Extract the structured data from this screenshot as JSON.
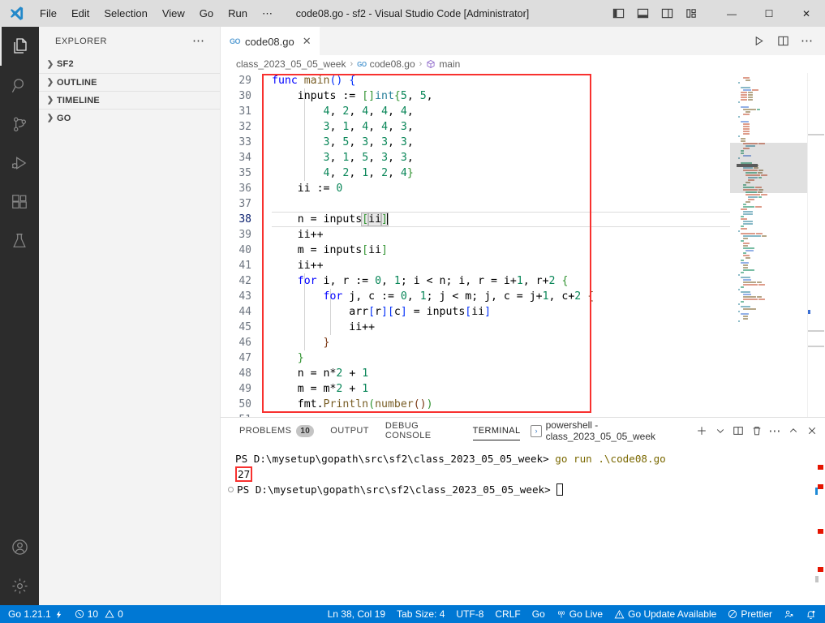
{
  "titlebar": {
    "logo_icon": "vscode-logo-icon",
    "menus": [
      "File",
      "Edit",
      "Selection",
      "View",
      "Go",
      "Run",
      "⋯"
    ],
    "title": "code08.go - sf2 - Visual Studio Code [Administrator]",
    "layout_icons": [
      "toggle-primary-sidebar-icon",
      "toggle-panel-icon",
      "toggle-secondary-sidebar-icon",
      "customize-layout-icon"
    ],
    "window_controls": {
      "minimize": "—",
      "maximize": "☐",
      "close": "✕"
    }
  },
  "activitybar": {
    "items": [
      {
        "name": "explorer",
        "icon": "files-icon",
        "active": true
      },
      {
        "name": "search",
        "icon": "search-icon",
        "active": false
      },
      {
        "name": "source-control",
        "icon": "source-control-icon",
        "active": false
      },
      {
        "name": "run-and-debug",
        "icon": "run-debug-icon",
        "active": false
      },
      {
        "name": "extensions",
        "icon": "extensions-icon",
        "active": false
      },
      {
        "name": "testing",
        "icon": "beaker-icon",
        "active": false
      }
    ],
    "bottom_items": [
      {
        "name": "accounts",
        "icon": "account-icon"
      },
      {
        "name": "manage",
        "icon": "gear-icon"
      }
    ]
  },
  "sidebar": {
    "header": "EXPLORER",
    "more_actions": "⋯",
    "sections": [
      {
        "label": "SF2",
        "expanded": false
      },
      {
        "label": "OUTLINE",
        "expanded": false
      },
      {
        "label": "TIMELINE",
        "expanded": false
      },
      {
        "label": "GO",
        "expanded": false
      }
    ]
  },
  "editor": {
    "tabs": [
      {
        "label": "code08.go",
        "icon": "go-file-icon",
        "close": "✕",
        "active": true
      }
    ],
    "actions": [
      "run-icon",
      "split-editor-icon",
      "more-actions-icon"
    ],
    "breadcrumb": [
      {
        "label": "class_2023_05_05_week",
        "icon": ""
      },
      {
        "label": "code08.go",
        "icon": "go-file-icon"
      },
      {
        "label": "main",
        "icon": "symbol-package-icon"
      }
    ],
    "breadcrumb_separator": "›",
    "first_line_number": 29,
    "lines": [
      {
        "n": 29,
        "tokens": [
          {
            "t": "func ",
            "c": "kw"
          },
          {
            "t": "main",
            "c": "fn"
          },
          {
            "t": "(",
            "c": "br1"
          },
          {
            "t": ")",
            "c": "br1"
          },
          {
            "t": " ",
            "c": "op"
          },
          {
            "t": "{",
            "c": "br1"
          }
        ]
      },
      {
        "n": 30,
        "tokens": [
          {
            "t": "    inputs ",
            "c": "op"
          },
          {
            "t": ":=",
            "c": "op"
          },
          {
            "t": " ",
            "c": "op"
          },
          {
            "t": "[",
            "c": "br2"
          },
          {
            "t": "]",
            "c": "br2"
          },
          {
            "t": "int",
            "c": "typ"
          },
          {
            "t": "{",
            "c": "br2"
          },
          {
            "t": "5",
            "c": "num"
          },
          {
            "t": ", ",
            "c": "op"
          },
          {
            "t": "5",
            "c": "num"
          },
          {
            "t": ",",
            "c": "op"
          }
        ]
      },
      {
        "n": 31,
        "tokens": [
          {
            "t": "        ",
            "c": "op"
          },
          {
            "t": "4",
            "c": "num"
          },
          {
            "t": ", ",
            "c": "op"
          },
          {
            "t": "2",
            "c": "num"
          },
          {
            "t": ", ",
            "c": "op"
          },
          {
            "t": "4",
            "c": "num"
          },
          {
            "t": ", ",
            "c": "op"
          },
          {
            "t": "4",
            "c": "num"
          },
          {
            "t": ", ",
            "c": "op"
          },
          {
            "t": "4",
            "c": "num"
          },
          {
            "t": ",",
            "c": "op"
          }
        ]
      },
      {
        "n": 32,
        "tokens": [
          {
            "t": "        ",
            "c": "op"
          },
          {
            "t": "3",
            "c": "num"
          },
          {
            "t": ", ",
            "c": "op"
          },
          {
            "t": "1",
            "c": "num"
          },
          {
            "t": ", ",
            "c": "op"
          },
          {
            "t": "4",
            "c": "num"
          },
          {
            "t": ", ",
            "c": "op"
          },
          {
            "t": "4",
            "c": "num"
          },
          {
            "t": ", ",
            "c": "op"
          },
          {
            "t": "3",
            "c": "num"
          },
          {
            "t": ",",
            "c": "op"
          }
        ]
      },
      {
        "n": 33,
        "tokens": [
          {
            "t": "        ",
            "c": "op"
          },
          {
            "t": "3",
            "c": "num"
          },
          {
            "t": ", ",
            "c": "op"
          },
          {
            "t": "5",
            "c": "num"
          },
          {
            "t": ", ",
            "c": "op"
          },
          {
            "t": "3",
            "c": "num"
          },
          {
            "t": ", ",
            "c": "op"
          },
          {
            "t": "3",
            "c": "num"
          },
          {
            "t": ", ",
            "c": "op"
          },
          {
            "t": "3",
            "c": "num"
          },
          {
            "t": ",",
            "c": "op"
          }
        ]
      },
      {
        "n": 34,
        "tokens": [
          {
            "t": "        ",
            "c": "op"
          },
          {
            "t": "3",
            "c": "num"
          },
          {
            "t": ", ",
            "c": "op"
          },
          {
            "t": "1",
            "c": "num"
          },
          {
            "t": ", ",
            "c": "op"
          },
          {
            "t": "5",
            "c": "num"
          },
          {
            "t": ", ",
            "c": "op"
          },
          {
            "t": "3",
            "c": "num"
          },
          {
            "t": ", ",
            "c": "op"
          },
          {
            "t": "3",
            "c": "num"
          },
          {
            "t": ",",
            "c": "op"
          }
        ]
      },
      {
        "n": 35,
        "tokens": [
          {
            "t": "        ",
            "c": "op"
          },
          {
            "t": "4",
            "c": "num"
          },
          {
            "t": ", ",
            "c": "op"
          },
          {
            "t": "2",
            "c": "num"
          },
          {
            "t": ", ",
            "c": "op"
          },
          {
            "t": "1",
            "c": "num"
          },
          {
            "t": ", ",
            "c": "op"
          },
          {
            "t": "2",
            "c": "num"
          },
          {
            "t": ", ",
            "c": "op"
          },
          {
            "t": "4",
            "c": "num"
          },
          {
            "t": "}",
            "c": "br2"
          }
        ]
      },
      {
        "n": 36,
        "tokens": [
          {
            "t": "    ii ",
            "c": "op"
          },
          {
            "t": ":=",
            "c": "op"
          },
          {
            "t": " ",
            "c": "op"
          },
          {
            "t": "0",
            "c": "num"
          }
        ]
      },
      {
        "n": 37,
        "tokens": []
      },
      {
        "n": 38,
        "tokens": [
          {
            "t": "    n ",
            "c": "op"
          },
          {
            "t": "=",
            "c": "op"
          },
          {
            "t": " inputs",
            "c": "op"
          },
          {
            "t": "[",
            "c": "br2"
          },
          {
            "t": "ii",
            "c": "op"
          },
          {
            "t": "]",
            "c": "br2"
          }
        ],
        "current": true
      },
      {
        "n": 39,
        "tokens": [
          {
            "t": "    ii++",
            "c": "op"
          }
        ]
      },
      {
        "n": 40,
        "tokens": [
          {
            "t": "    m ",
            "c": "op"
          },
          {
            "t": "=",
            "c": "op"
          },
          {
            "t": " inputs",
            "c": "op"
          },
          {
            "t": "[",
            "c": "br2"
          },
          {
            "t": "ii",
            "c": "op"
          },
          {
            "t": "]",
            "c": "br2"
          }
        ]
      },
      {
        "n": 41,
        "tokens": [
          {
            "t": "    ii++",
            "c": "op"
          }
        ]
      },
      {
        "n": 42,
        "tokens": [
          {
            "t": "    ",
            "c": "op"
          },
          {
            "t": "for",
            "c": "kw"
          },
          {
            "t": " i, r ",
            "c": "op"
          },
          {
            "t": ":=",
            "c": "op"
          },
          {
            "t": " ",
            "c": "op"
          },
          {
            "t": "0",
            "c": "num"
          },
          {
            "t": ", ",
            "c": "op"
          },
          {
            "t": "1",
            "c": "num"
          },
          {
            "t": "; i < n; i, r ",
            "c": "op"
          },
          {
            "t": "=",
            "c": "op"
          },
          {
            "t": " i+",
            "c": "op"
          },
          {
            "t": "1",
            "c": "num"
          },
          {
            "t": ", r+",
            "c": "op"
          },
          {
            "t": "2",
            "c": "num"
          },
          {
            "t": " ",
            "c": "op"
          },
          {
            "t": "{",
            "c": "br2"
          }
        ]
      },
      {
        "n": 43,
        "tokens": [
          {
            "t": "        ",
            "c": "op"
          },
          {
            "t": "for",
            "c": "kw"
          },
          {
            "t": " j, c ",
            "c": "op"
          },
          {
            "t": ":=",
            "c": "op"
          },
          {
            "t": " ",
            "c": "op"
          },
          {
            "t": "0",
            "c": "num"
          },
          {
            "t": ", ",
            "c": "op"
          },
          {
            "t": "1",
            "c": "num"
          },
          {
            "t": "; j < m; j, c ",
            "c": "op"
          },
          {
            "t": "=",
            "c": "op"
          },
          {
            "t": " j+",
            "c": "op"
          },
          {
            "t": "1",
            "c": "num"
          },
          {
            "t": ", c+",
            "c": "op"
          },
          {
            "t": "2",
            "c": "num"
          },
          {
            "t": " ",
            "c": "op"
          },
          {
            "t": "{",
            "c": "br3"
          }
        ]
      },
      {
        "n": 44,
        "tokens": [
          {
            "t": "            arr",
            "c": "op"
          },
          {
            "t": "[",
            "c": "br1"
          },
          {
            "t": "r",
            "c": "op"
          },
          {
            "t": "]",
            "c": "br1"
          },
          {
            "t": "[",
            "c": "br1"
          },
          {
            "t": "c",
            "c": "op"
          },
          {
            "t": "]",
            "c": "br1"
          },
          {
            "t": " ",
            "c": "op"
          },
          {
            "t": "=",
            "c": "op"
          },
          {
            "t": " inputs",
            "c": "op"
          },
          {
            "t": "[",
            "c": "br1"
          },
          {
            "t": "ii",
            "c": "op"
          },
          {
            "t": "]",
            "c": "br1"
          }
        ]
      },
      {
        "n": 45,
        "tokens": [
          {
            "t": "            ii++",
            "c": "op"
          }
        ]
      },
      {
        "n": 46,
        "tokens": [
          {
            "t": "        ",
            "c": "op"
          },
          {
            "t": "}",
            "c": "br3"
          }
        ]
      },
      {
        "n": 47,
        "tokens": [
          {
            "t": "    ",
            "c": "op"
          },
          {
            "t": "}",
            "c": "br2"
          }
        ]
      },
      {
        "n": 48,
        "tokens": [
          {
            "t": "    n ",
            "c": "op"
          },
          {
            "t": "=",
            "c": "op"
          },
          {
            "t": " n*",
            "c": "op"
          },
          {
            "t": "2",
            "c": "num"
          },
          {
            "t": " + ",
            "c": "op"
          },
          {
            "t": "1",
            "c": "num"
          }
        ]
      },
      {
        "n": 49,
        "tokens": [
          {
            "t": "    m ",
            "c": "op"
          },
          {
            "t": "=",
            "c": "op"
          },
          {
            "t": " m*",
            "c": "op"
          },
          {
            "t": "2",
            "c": "num"
          },
          {
            "t": " + ",
            "c": "op"
          },
          {
            "t": "1",
            "c": "num"
          }
        ]
      },
      {
        "n": 50,
        "tokens": [
          {
            "t": "    fmt.",
            "c": "op"
          },
          {
            "t": "Println",
            "c": "fn"
          },
          {
            "t": "(",
            "c": "br2"
          },
          {
            "t": "number",
            "c": "fn"
          },
          {
            "t": "(",
            "c": "br3"
          },
          {
            "t": ")",
            "c": "br3"
          },
          {
            "t": ")",
            "c": "br2"
          }
        ]
      },
      {
        "n": 51,
        "tokens": []
      }
    ],
    "annotation_box_color": "#f8312f"
  },
  "panel": {
    "tabs": [
      {
        "label": "PROBLEMS",
        "badge": "10",
        "active": false
      },
      {
        "label": "OUTPUT",
        "badge": null,
        "active": false
      },
      {
        "label": "DEBUG CONSOLE",
        "badge": null,
        "active": false
      },
      {
        "label": "TERMINAL",
        "badge": null,
        "active": true
      }
    ],
    "terminal_selector": "powershell - class_2023_05_05_week",
    "terminal_selector_icon": "terminal-icon",
    "actions": [
      "new-terminal-icon",
      "terminal-dropdown-icon",
      "split-terminal-icon",
      "kill-terminal-icon",
      "more-actions-icon",
      "maximize-panel-icon",
      "close-panel-icon"
    ],
    "terminal_lines": [
      {
        "type": "prompt",
        "prompt": "PS D:\\mysetup\\gopath\\src\\sf2\\class_2023_05_05_week>",
        "command": " go run .\\code08.go",
        "marker": false
      },
      {
        "type": "output",
        "text": "27",
        "highlighted": true
      },
      {
        "type": "prompt",
        "prompt": "PS D:\\mysetup\\gopath\\src\\sf2\\class_2023_05_05_week>",
        "command": "",
        "marker": true,
        "cursor": true
      }
    ],
    "output_highlight_color": "#f8312f"
  },
  "statusbar": {
    "left": [
      {
        "name": "go-version",
        "icon": "",
        "label": "Go 1.21.1",
        "trailing_icon": "lightning-icon"
      },
      {
        "name": "problems",
        "icon": "error-icon",
        "label": "10",
        "icon2": "warning-icon",
        "label2": "0"
      }
    ],
    "right": [
      {
        "name": "cursor-position",
        "label": "Ln 38, Col 19"
      },
      {
        "name": "indentation",
        "label": "Tab Size: 4"
      },
      {
        "name": "encoding",
        "label": "UTF-8"
      },
      {
        "name": "eol",
        "label": "CRLF"
      },
      {
        "name": "language-mode",
        "label": "Go"
      },
      {
        "name": "go-live",
        "icon": "broadcast-icon",
        "label": "Go Live"
      },
      {
        "name": "go-update",
        "icon": "warning-icon",
        "label": "Go Update Available"
      },
      {
        "name": "prettier",
        "icon": "prohibited-icon",
        "label": "Prettier"
      },
      {
        "name": "remote-share",
        "icon": "live-share-icon",
        "label": ""
      },
      {
        "name": "notifications",
        "icon": "bell-dot-icon",
        "label": ""
      }
    ],
    "background_color": "#0078d4"
  }
}
